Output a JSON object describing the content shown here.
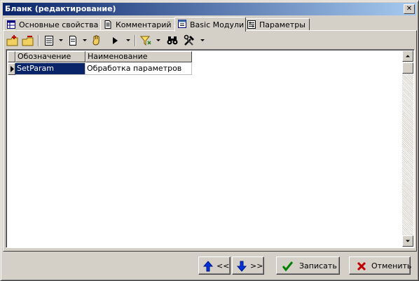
{
  "window": {
    "title": "Бланк (редактирование)"
  },
  "tabs": [
    {
      "label": "Основные свойства",
      "icon": "table-icon"
    },
    {
      "label": "Комментарий",
      "icon": "document-icon"
    },
    {
      "label": "Basic Модули",
      "icon": "module-icon",
      "active": true
    },
    {
      "label": "Параметры",
      "icon": "params-icon"
    }
  ],
  "toolbar": {
    "icons": [
      "add-folder-icon",
      "remove-folder-icon",
      "list-icon",
      "page-icon",
      "hand-icon",
      "run-icon",
      "filter-icon",
      "binoculars-icon",
      "tools-icon"
    ]
  },
  "grid": {
    "columns": [
      "Обозначение",
      "Наименование"
    ],
    "rows": [
      [
        "SetParam",
        "Обработка параметров"
      ]
    ]
  },
  "buttons": {
    "prev_label": "<<",
    "next_label": ">>",
    "save_label": "Записать",
    "cancel_label": "Отменить"
  },
  "colors": {
    "titlebar_start": "#0a246a",
    "titlebar_end": "#a6caf0",
    "selection": "#0a246a"
  }
}
